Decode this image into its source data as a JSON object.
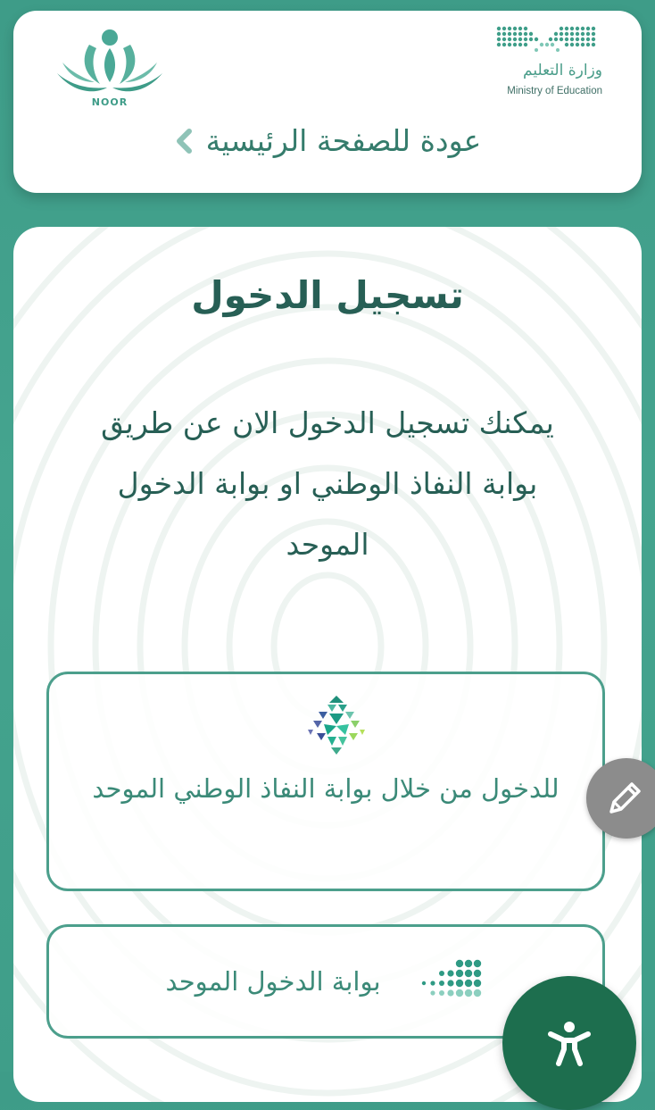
{
  "header": {
    "noor_logo_text": "NOOR",
    "moe_name_ar": "وزارة التعليم",
    "moe_name_en": "Ministry of Education",
    "back_label": "عودة للصفحة الرئيسية",
    "back_icon": "chevron-left-icon"
  },
  "login": {
    "title": "تسجيل الدخول",
    "description": "يمكنك تسجيل الدخول الان عن طريق بوابة النفاذ الوطني او بوابة الدخول الموحد",
    "nafath_option": {
      "label": "للدخول من خلال بوابة النفاذ الوطني الموحد",
      "icon": "nafath-logo-icon"
    },
    "unified_option": {
      "label": "بوابة الدخول الموحد",
      "icon": "unified-login-logo-icon"
    }
  },
  "floating": {
    "edit_icon": "pencil-icon",
    "accessibility_icon": "accessibility-icon"
  },
  "colors": {
    "background": "#45a48f",
    "primary_text": "#275f55",
    "accent": "#4c9f8c",
    "accessibility_button": "#1d6e4e",
    "edit_button": "#8c8c8c"
  }
}
